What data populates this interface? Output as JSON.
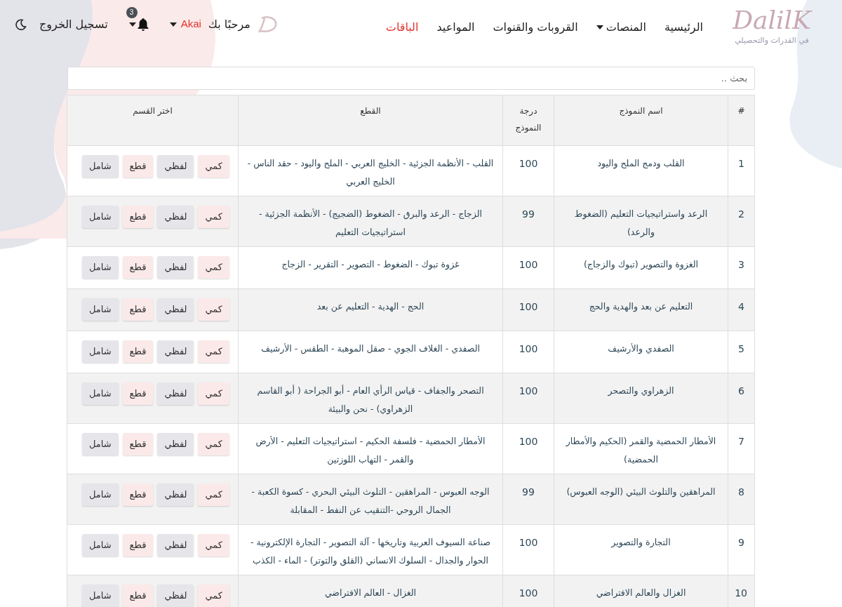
{
  "logo": {
    "text": "DalilK",
    "tagline": "في القدرات والتحصيلي"
  },
  "nav": [
    {
      "label": "الرئيسية",
      "selected": false,
      "dropdown": false
    },
    {
      "label": "المنصات",
      "selected": false,
      "dropdown": true
    },
    {
      "label": "القروبات والقنوات",
      "selected": false,
      "dropdown": false
    },
    {
      "label": "المواعيد",
      "selected": false,
      "dropdown": false
    },
    {
      "label": "الباقات",
      "selected": true,
      "dropdown": false
    }
  ],
  "user": {
    "greeting": "مرحبًا بك",
    "name": "Akai",
    "notifications": "3",
    "logout": "تسجيل الخروج"
  },
  "search": {
    "placeholder": "بحث .."
  },
  "table": {
    "columns": [
      "#",
      "اسم النموذج",
      "درجة النموذج",
      "القطع",
      "اختر القسم"
    ],
    "rows": [
      {
        "index": "1",
        "name": "القلب ودمج الملح واليود",
        "score": "100",
        "pieces": "القلب - الأنظمة الجزئية - الخليج العربي - الملح واليود - حقد الناس - الخليج العربي",
        "sections": [
          {
            "label": "كمي",
            "color": "#fbe9e9"
          },
          {
            "label": "لفظي",
            "color": "#e6e6ea"
          },
          {
            "label": "قطع",
            "color": "#fbe9e9"
          },
          {
            "label": "شامل",
            "color": "#e6e6ea"
          }
        ]
      },
      {
        "index": "2",
        "name": "الرعد واستراتيجيات التعليم (الضغوط والرعد)",
        "score": "99",
        "pieces": "الزجاج - الرعد والبرق - الضغوط (الضجيج) - الأنظمة الجزئية - استراتيجيات التعليم",
        "sections": [
          {
            "label": "كمي",
            "color": "#fbe9e9"
          },
          {
            "label": "لفظي",
            "color": "#e6e6ea"
          },
          {
            "label": "قطع",
            "color": "#fbe9e9"
          },
          {
            "label": "شامل",
            "color": "#e6e6ea"
          }
        ]
      },
      {
        "index": "3",
        "name": "الغزوة والتصوير (تبوك والزجاج)",
        "score": "100",
        "pieces": "غزوة تبوك - الضغوط  -  التصوير - التقرير  - الزجاج",
        "sections": [
          {
            "label": "كمي",
            "color": "#fbe9e9"
          },
          {
            "label": "لفظي",
            "color": "#e6e6ea"
          },
          {
            "label": "قطع",
            "color": "#fbe9e9"
          },
          {
            "label": "شامل",
            "color": "#e6e6ea"
          }
        ]
      },
      {
        "index": "4",
        "name": "التعليم عن بعد والهدية والحج",
        "score": "100",
        "pieces": "الحج - الهدية - التعليم عن بعد",
        "sections": [
          {
            "label": "كمي",
            "color": "#fbe9e9"
          },
          {
            "label": "لفظي",
            "color": "#e6e6ea"
          },
          {
            "label": "قطع",
            "color": "#fbe9e9"
          },
          {
            "label": "شامل",
            "color": "#e6e6ea"
          }
        ]
      },
      {
        "index": "5",
        "name": "الصفدي والأرشيف",
        "score": "100",
        "pieces": "الصفدي - الغلاف الجوي - صقل الموهبة - الطقس - الأرشيف",
        "sections": [
          {
            "label": "كمي",
            "color": "#fbe9e9"
          },
          {
            "label": "لفظي",
            "color": "#e6e6ea"
          },
          {
            "label": "قطع",
            "color": "#fbe9e9"
          },
          {
            "label": "شامل",
            "color": "#e6e6ea"
          }
        ]
      },
      {
        "index": "6",
        "name": "الزهراوي والتصحر",
        "score": "100",
        "pieces": "التصحر والجفاف  - قياس الرأي العام  - أبو الجراحة ( أبو القاسم الزهراوي)  - نحن والبيئة",
        "sections": [
          {
            "label": "كمي",
            "color": "#fbe9e9"
          },
          {
            "label": "لفظي",
            "color": "#e6e6ea"
          },
          {
            "label": "قطع",
            "color": "#fbe9e9"
          },
          {
            "label": "شامل",
            "color": "#e6e6ea"
          }
        ]
      },
      {
        "index": "7",
        "name": "الأمطار الحمضية والقمر (الحكيم والأمطار الحمضية)",
        "score": "100",
        "pieces": "الأمطار الحمضية - فلسفة الحكيم - استراتيجيات التعليم - الأرض والقمر - التهاب اللوزتين",
        "sections": [
          {
            "label": "كمي",
            "color": "#fbe9e9"
          },
          {
            "label": "لفظي",
            "color": "#e6e6ea"
          },
          {
            "label": "قطع",
            "color": "#fbe9e9"
          },
          {
            "label": "شامل",
            "color": "#e6e6ea"
          }
        ]
      },
      {
        "index": "8",
        "name": "المراهقين والتلوث البيئي (الوجه العبوس)",
        "score": "99",
        "pieces": "الوجه العبوس - المراهقين - التلوث البيئي البحري - كسوة الكعبة - الجمال الروحي -التنقيب عن النفط - المقابلة",
        "sections": [
          {
            "label": "كمي",
            "color": "#fbe9e9"
          },
          {
            "label": "لفظي",
            "color": "#e6e6ea"
          },
          {
            "label": "قطع",
            "color": "#fbe9e9"
          },
          {
            "label": "شامل",
            "color": "#e6e6ea"
          }
        ]
      },
      {
        "index": "9",
        "name": "التجارة والتصوير",
        "score": "100",
        "pieces": "صناعة السيوف العربية وتاريخها - آلة التصوير - التجارة الإلكترونية - الحوار والجدال - السلوك الانساني (القلق والتوتر) - الماء - الكذب",
        "sections": [
          {
            "label": "كمي",
            "color": "#fbe9e9"
          },
          {
            "label": "لفظي",
            "color": "#e6e6ea"
          },
          {
            "label": "قطع",
            "color": "#fbe9e9"
          },
          {
            "label": "شامل",
            "color": "#e6e6ea"
          }
        ]
      },
      {
        "index": "10",
        "name": "الغزال والعالم الافتراضي",
        "score": "100",
        "pieces": "الغزال - العالم الافتراضي",
        "sections": [
          {
            "label": "كمي",
            "color": "#fbe9e9"
          },
          {
            "label": "لفظي",
            "color": "#e6e6ea"
          },
          {
            "label": "قطع",
            "color": "#fbe9e9"
          },
          {
            "label": "شامل",
            "color": "#e6e6ea"
          }
        ]
      }
    ]
  }
}
